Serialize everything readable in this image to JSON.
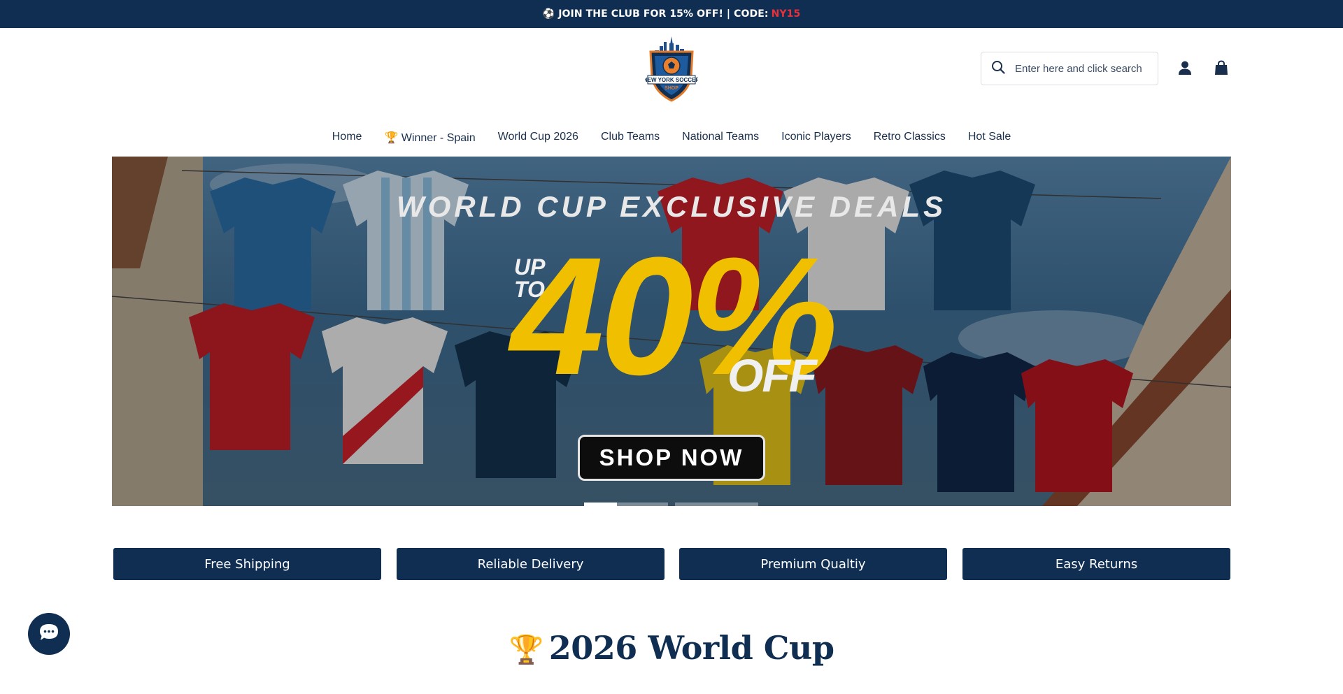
{
  "announcement": {
    "icon": "soccer-ball-icon",
    "text": "JOIN THE CLUB FOR 15% OFF! | CODE:",
    "code": "NY15",
    "code_color": "#e8313a",
    "background": "#0f2e52"
  },
  "logo": {
    "line1": "NEW YORK SOCCER",
    "line2": "SHOP"
  },
  "search": {
    "placeholder": "Enter here and click search",
    "value": ""
  },
  "header_icons": [
    "account-icon",
    "cart-bag-icon"
  ],
  "nav": {
    "items": [
      {
        "label": "Home"
      },
      {
        "label": "🏆 Winner - Spain"
      },
      {
        "label": "World Cup 2026"
      },
      {
        "label": "Club Teams"
      },
      {
        "label": "National Teams"
      },
      {
        "label": "Iconic Players"
      },
      {
        "label": "Retro Classics"
      },
      {
        "label": "Hot Sale"
      }
    ]
  },
  "hero": {
    "headline": "WORLD CUP EXCLUSIVE DEALS",
    "up_to": "UP",
    "to": "TO",
    "discount": "40%",
    "off": "OFF",
    "cta": "SHOP NOW",
    "accent": "#f0c000",
    "slides": 3,
    "active_slide": 1
  },
  "features": [
    {
      "label": "Free Shipping"
    },
    {
      "label": "Reliable Delivery"
    },
    {
      "label": "Premium Qualtiy"
    },
    {
      "label": "Easy Returns"
    }
  ],
  "chat": {
    "icon": "chat-bubble-icon"
  },
  "section": {
    "icon": "🏆",
    "title": "2026 World Cup"
  },
  "colors": {
    "brand": "#0f2e52",
    "text": "#1a2f4d"
  }
}
